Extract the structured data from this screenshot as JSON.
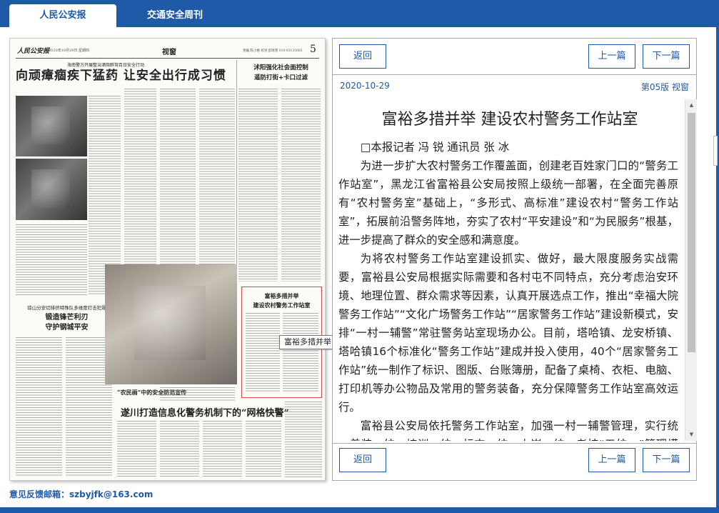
{
  "tabs": [
    {
      "label": "人民公安报"
    },
    {
      "label": "交通安全周刊"
    }
  ],
  "newspaper": {
    "logo": "人民公安报",
    "date_line": "2020年10月29日 星期四",
    "section": "视窗",
    "contact": "责编 陈小春 校对 彭晓雪 010-83135081",
    "page_number": "5",
    "kicker": "海南警方开展整治酒驾醉驾百日安全行动",
    "headline": "向顽瘴痼疾下猛药 让安全出行成习惯",
    "side_headline": [
      "沭阳强化社会面控制",
      "遥防打街+卡口过滤"
    ],
    "sub_kicker": "琼山分安切排挤特殊队多维度打击犯罪",
    "sub_headline": [
      "锻造锋芒利刃",
      "守护钢城平安"
    ],
    "photo_caption": "“农民画”中的安全防范宣传",
    "bottom_headline": "遂川打造信息化警务机制下的“网格快警”",
    "highlight_box": [
      "富裕多措并举",
      "建设农村警务工作站室"
    ]
  },
  "tooltip": "富裕多措并举 建设农村警务工作站室",
  "article": {
    "back_label": "返回",
    "prev_label": "上一篇",
    "next_label": "下一篇",
    "date": "2020-10-29",
    "page_label": "第05版 视窗",
    "title": "富裕多措并举 建设农村警务工作站室",
    "byline": "□本报记者 冯 锐 通讯员 张 冰",
    "paragraphs": [
      "为进一步扩大农村警务工作覆盖面，创建老百姓家门口的“警务工作站室”，黑龙江省富裕县公安局按照上级统一部署，在全面完善原有“农村警务室”基础上，“多形式、高标准”建设农村“警务工作站室”，拓展前沿警务阵地，夯实了农村“平安建设”和“为民服务”根基，进一步提高了群众的安全感和满意度。",
      "为将农村警务工作站室建设抓实、做好，最大限度服务实战需要，富裕县公安局根据实际需要和各村屯不同特点，充分考虑治安环境、地理位置、群众需求等因素，认真开展选点工作，推出“幸福大院警务工作站”“文化广场警务工作站”“居家警务工作站”建设新模式，安排“一村一辅警”常驻警务站室现场办公。目前，塔哈镇、龙安桥镇、塔哈镇16个标准化“警务工作站”建成并投入使用，40个“居家警务工作站”统一制作了标识、图版、台账簿册，配备了桌椅、衣柜、电脑、打印机等办公物品及常用的警务装备，充分保障警务工作站室高效运行。",
      "富裕县公安局依托警务工作站室，加强一村一辅警管理，实行统一着装、统一培训、统一标志、统一上岗、统一考核“五统一”管理模式，围绕矛盾大调解、治安大防控、事故大劝导、信息大收集"
    ]
  },
  "feedback": "意见反馈邮箱：szbyjfk@163.com",
  "colors": {
    "accent": "#1e5aa8",
    "highlight_border": "#d84a4a"
  }
}
